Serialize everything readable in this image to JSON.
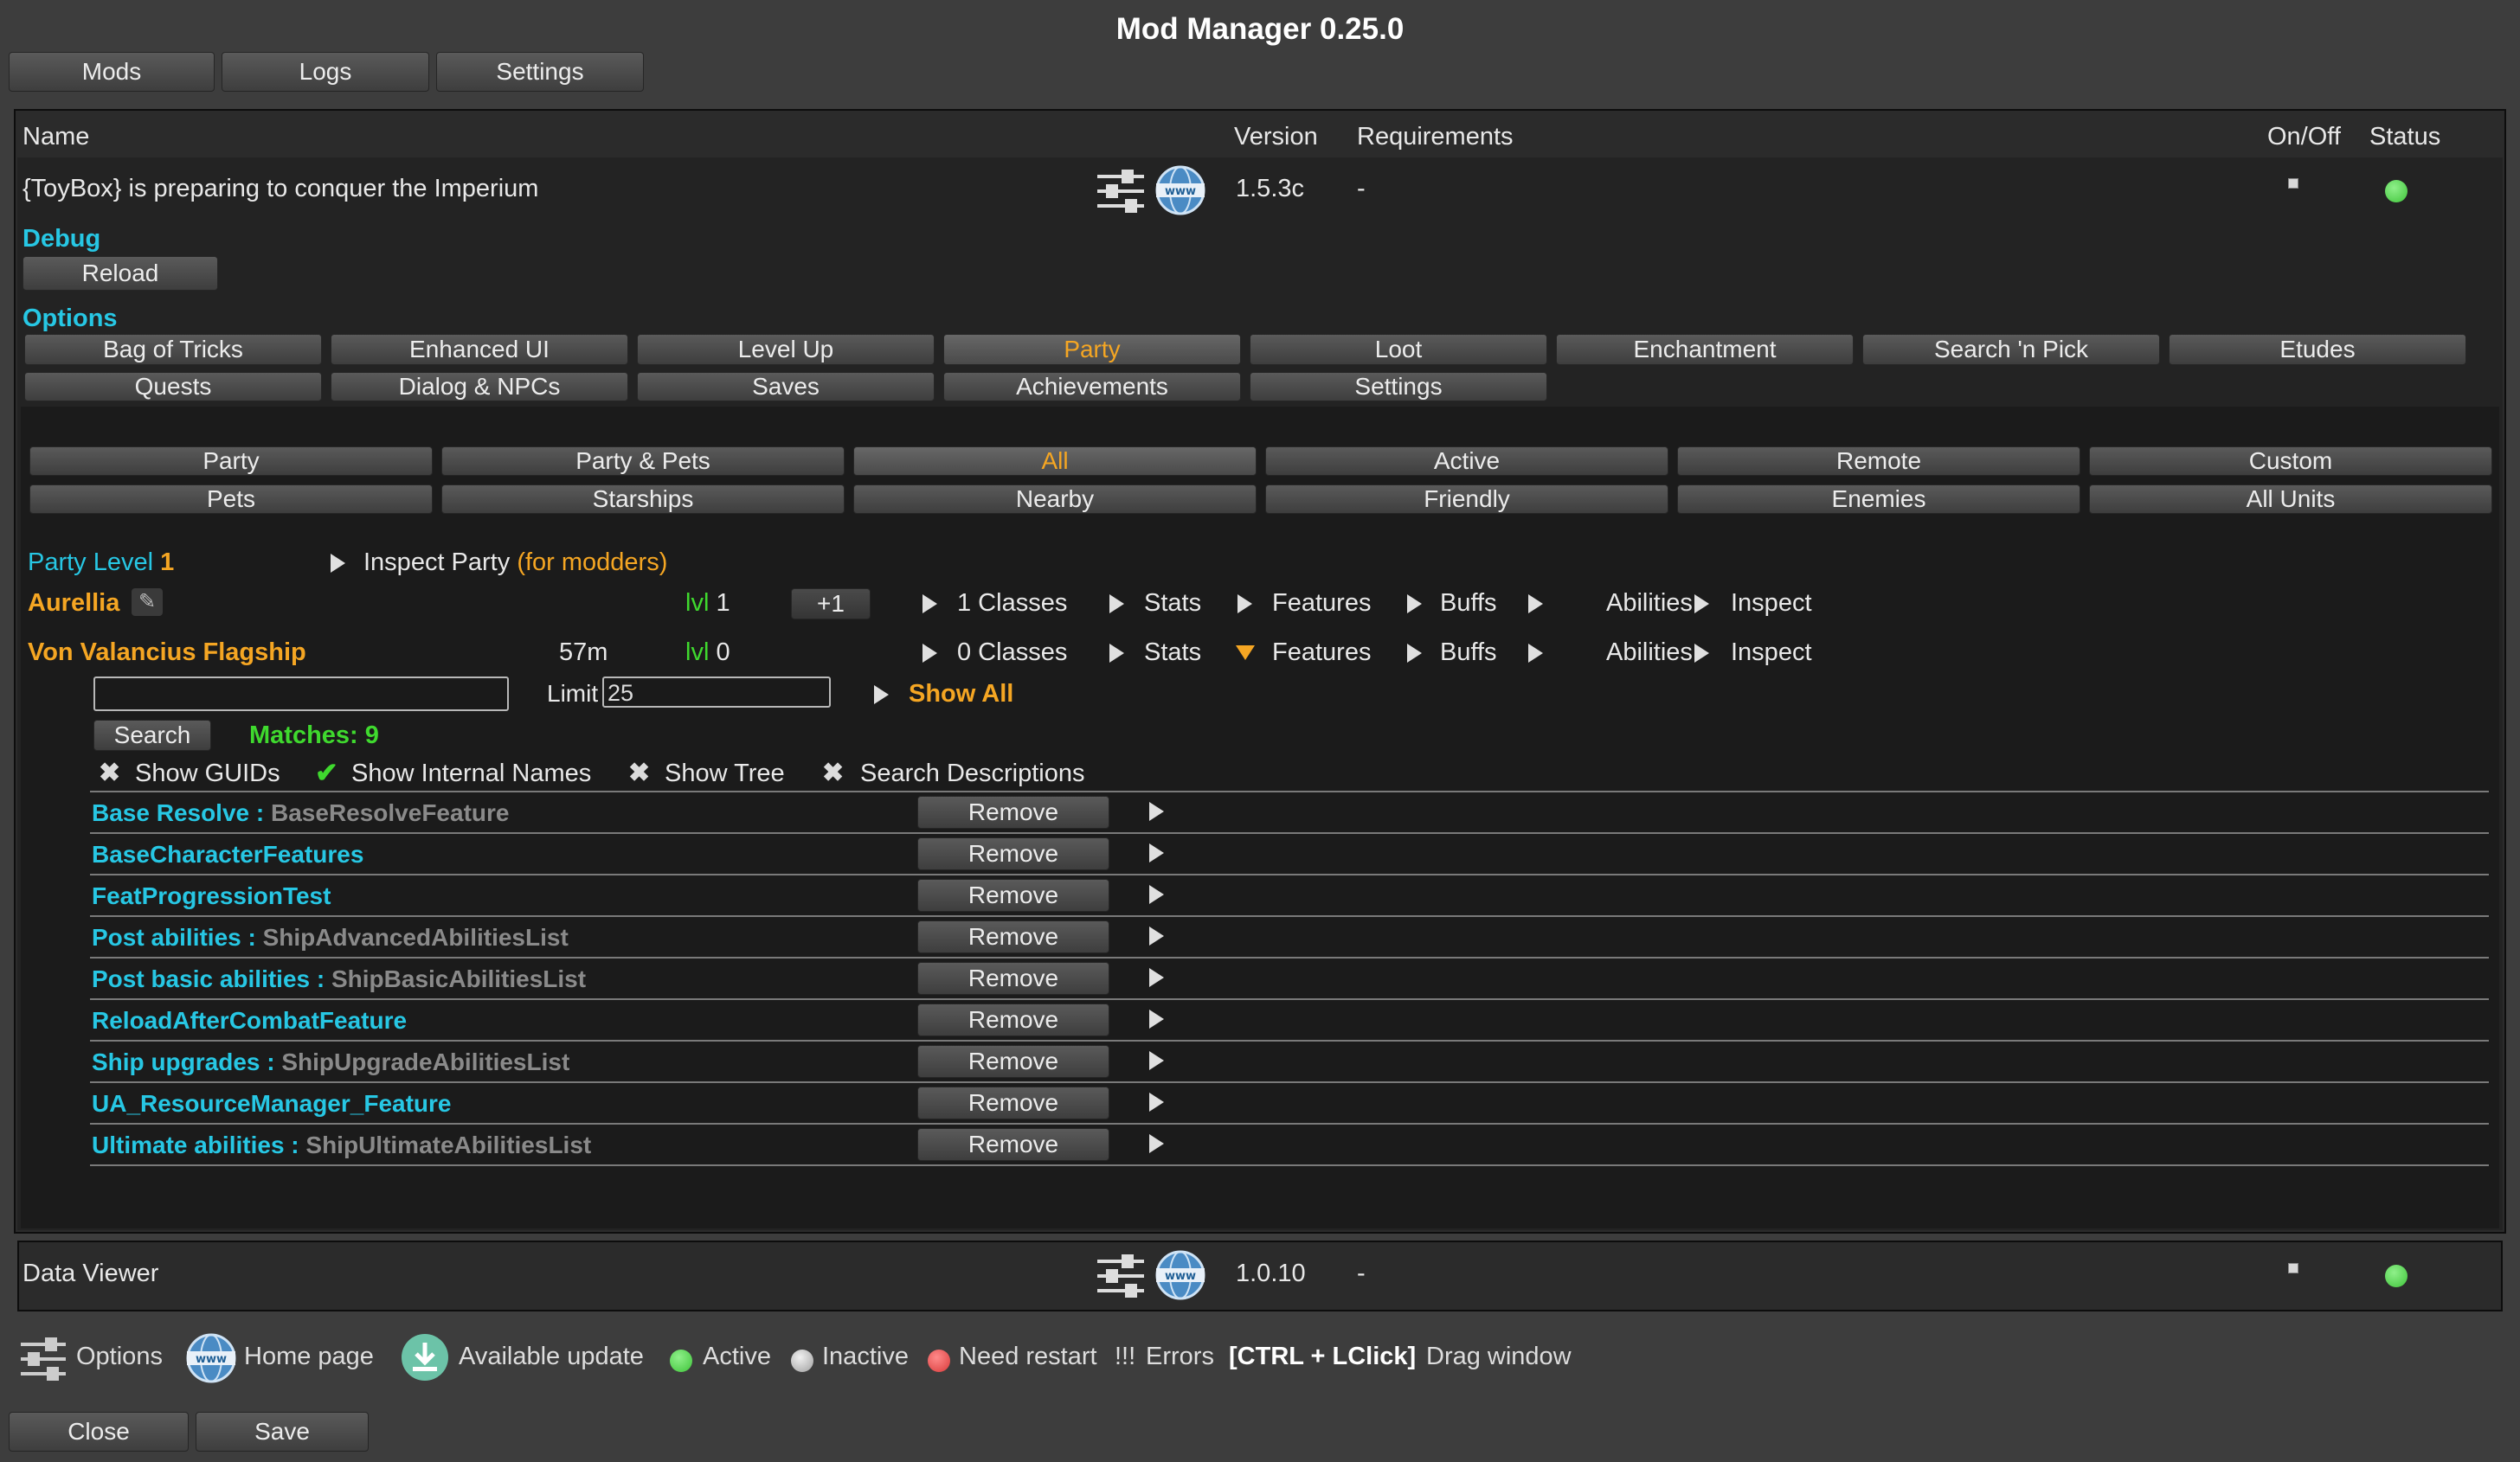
{
  "window": {
    "title": "Mod Manager 0.25.0"
  },
  "top_tabs": [
    "Mods",
    "Logs",
    "Settings"
  ],
  "header": {
    "name": "Name",
    "version": "Version",
    "requirements": "Requirements",
    "onoff": "On/Off",
    "status": "Status"
  },
  "mods": [
    {
      "name": "{ToyBox} is preparing to conquer the Imperium",
      "version": "1.5.3c",
      "requirements": "-"
    },
    {
      "name": "Data Viewer",
      "version": "1.0.10",
      "requirements": "-"
    }
  ],
  "debug": {
    "label": "Debug",
    "reload": "Reload"
  },
  "options": {
    "label": "Options",
    "tabs_row1": [
      "Bag of Tricks",
      "Enhanced UI",
      "Level Up",
      "Party",
      "Loot",
      "Enchantment",
      "Search 'n Pick",
      "Etudes"
    ],
    "tabs_row2": [
      "Quests",
      "Dialog & NPCs",
      "Saves",
      "Achievements",
      "Settings"
    ],
    "selected": "Party"
  },
  "filters": {
    "row1": [
      "Party",
      "Party & Pets",
      "All",
      "Active",
      "Remote",
      "Custom"
    ],
    "row2": [
      "Pets",
      "Starships",
      "Nearby",
      "Friendly",
      "Enemies",
      "All Units"
    ],
    "selected": "All"
  },
  "party": {
    "level_label": "Party Level",
    "level_value": "1",
    "inspect": "Inspect Party",
    "inspect_note": "(for modders)",
    "members": [
      {
        "name": "Aurellia",
        "distance": "",
        "lvl_label": "lvl",
        "lvl": "1",
        "plus": "+1",
        "classes": "1 Classes",
        "stats": "Stats",
        "features": "Features",
        "buffs": "Buffs",
        "abilities": "Abilities",
        "inspect": "Inspect"
      },
      {
        "name": "Von Valancius Flagship",
        "distance": "57m",
        "lvl_label": "lvl",
        "lvl": "0",
        "classes": "0 Classes",
        "stats": "Stats",
        "features": "Features",
        "buffs": "Buffs",
        "abilities": "Abilities",
        "inspect": "Inspect"
      }
    ]
  },
  "search": {
    "query": "",
    "limit_label": "Limit",
    "limit_value": "25",
    "show_all": "Show All",
    "button": "Search",
    "matches": "Matches: 9",
    "show_guids": "Show GUIDs",
    "show_internal": "Show Internal Names",
    "show_tree": "Show Tree",
    "search_desc": "Search Descriptions"
  },
  "features": [
    {
      "name": "Base Resolve",
      "sep": " : ",
      "internal": "BaseResolveFeature",
      "action": "Remove"
    },
    {
      "name": "BaseCharacterFeatures",
      "sep": "",
      "internal": "",
      "action": "Remove"
    },
    {
      "name": "FeatProgressionTest",
      "sep": "",
      "internal": "",
      "action": "Remove"
    },
    {
      "name": "Post abilities",
      "sep": " : ",
      "internal": "ShipAdvancedAbilitiesList",
      "action": "Remove"
    },
    {
      "name": "Post basic abilities",
      "sep": " : ",
      "internal": "ShipBasicAbilitiesList",
      "action": "Remove"
    },
    {
      "name": "ReloadAfterCombatFeature",
      "sep": "",
      "internal": "",
      "action": "Remove"
    },
    {
      "name": "Ship upgrades",
      "sep": " : ",
      "internal": "ShipUpgradeAbilitiesList",
      "action": "Remove"
    },
    {
      "name": "UA_ResourceManager_Feature",
      "sep": "",
      "internal": "",
      "action": "Remove"
    },
    {
      "name": "Ultimate abilities",
      "sep": " : ",
      "internal": "ShipUltimateAbilitiesList",
      "action": "Remove"
    }
  ],
  "legend": {
    "options": "Options",
    "homepage": "Home page",
    "update": "Available update",
    "active": "Active",
    "inactive": "Inactive",
    "restart": "Need restart",
    "errors_mark": "!!!",
    "errors": "Errors",
    "shortcut": "[CTRL + LClick]",
    "drag": "Drag window"
  },
  "footer": {
    "close": "Close",
    "save": "Save"
  },
  "colors": {
    "accent": "#f5a623",
    "feature_name": "#27c7e4",
    "level_green": "#3fd92e",
    "status_active": "#3fc43a",
    "status_restart": "#d93a3a"
  }
}
